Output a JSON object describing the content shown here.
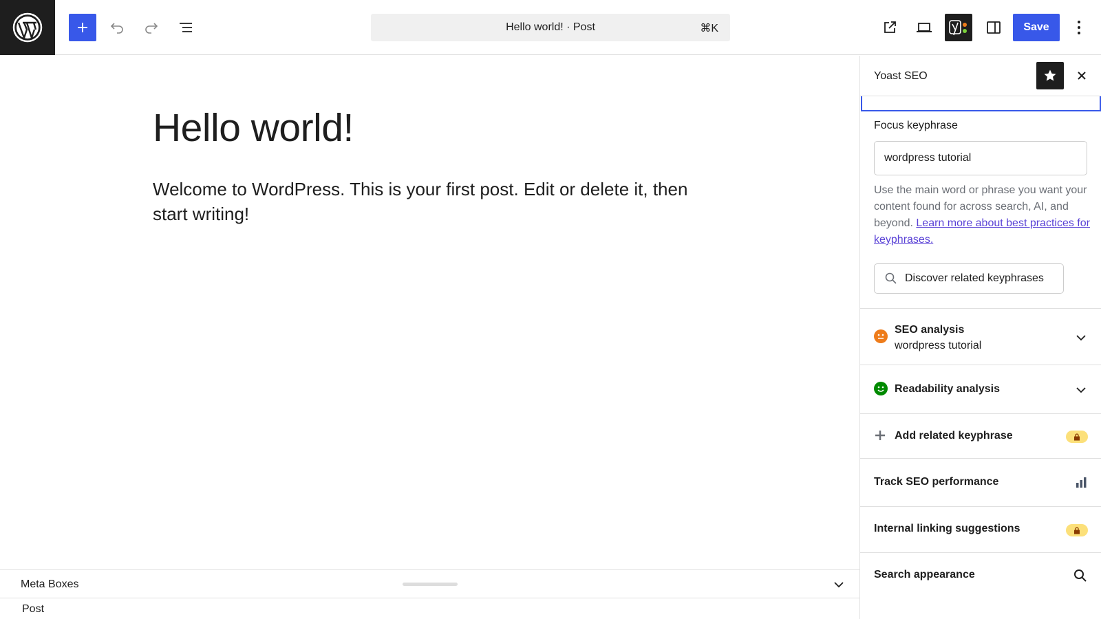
{
  "topbar": {
    "logo_icon": "wordpress-logo-icon",
    "command": {
      "title": "Hello world! · Post",
      "shortcut": "⌘K"
    },
    "save_label": "Save"
  },
  "editor": {
    "title": "Hello world!",
    "body": "Welcome to WordPress. This is your first post. Edit or delete it, then start writing!"
  },
  "metabox": {
    "label": "Meta Boxes"
  },
  "breadcrumb": {
    "label": "Post"
  },
  "sidebar": {
    "title": "Yoast SEO",
    "focus_keyphrase": {
      "label": "Focus keyphrase",
      "value": "wordpress tutorial",
      "help": "Use the main word or phrase you want your content found for across search, AI, and beyond. ",
      "link": "Learn more about best practices for keyphrases.",
      "discover_label": "Discover related keyphrases"
    },
    "panels": {
      "seo": {
        "title": "SEO analysis",
        "subtitle": "wordpress tutorial",
        "status_color": "#ee7c1b"
      },
      "readability": {
        "title": "Readability analysis",
        "status_color": "#008a00"
      },
      "related": {
        "title": "Add related keyphrase"
      },
      "track": {
        "title": "Track SEO performance"
      },
      "linking": {
        "title": "Internal linking suggestions"
      },
      "search": {
        "title": "Search appearance"
      }
    }
  },
  "colors": {
    "accent": "#3858e9",
    "dark": "#1e1e1e",
    "badge": "#fce07a"
  }
}
